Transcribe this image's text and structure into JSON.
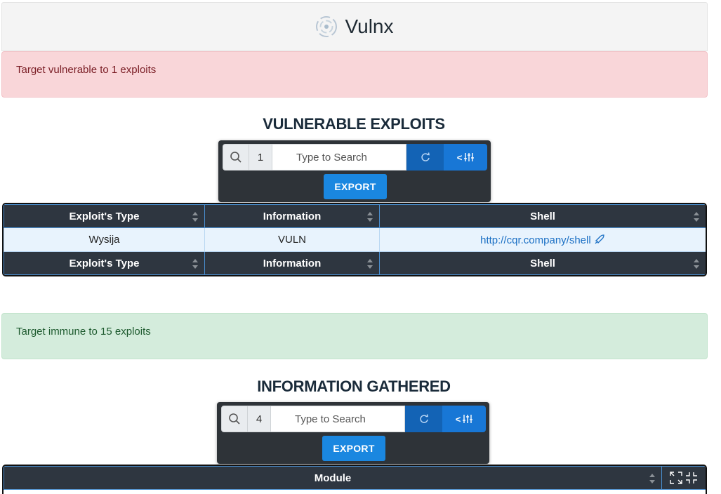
{
  "header": {
    "title": "Vulnx",
    "logo_icon": "radar-logo-icon"
  },
  "alerts": {
    "vulnerable": "Target vulnerable to 1 exploits",
    "immune": "Target immune to 15 exploits"
  },
  "exploits_section": {
    "title": "VULNERABLE EXPLOITS",
    "toolbar": {
      "count": "1",
      "search_placeholder": "Type to Search",
      "filter_label": "<",
      "export_label": "EXPORT"
    },
    "columns": [
      "Exploit's Type",
      "Information",
      "Shell"
    ],
    "rows": [
      {
        "type": "Wysija",
        "information": "VULN",
        "shell": "http://cqr.company/shell"
      }
    ]
  },
  "info_section": {
    "title": "INFORMATION GATHERED",
    "toolbar": {
      "count": "4",
      "search_placeholder": "Type to Search",
      "filter_label": "<",
      "export_label": "EXPORT"
    },
    "columns": [
      "Module"
    ]
  },
  "colors": {
    "danger_bg": "#f9d6d9",
    "success_bg": "#d4ecdc",
    "table_header": "#2e3640",
    "accent_blue": "#1a87e0"
  }
}
